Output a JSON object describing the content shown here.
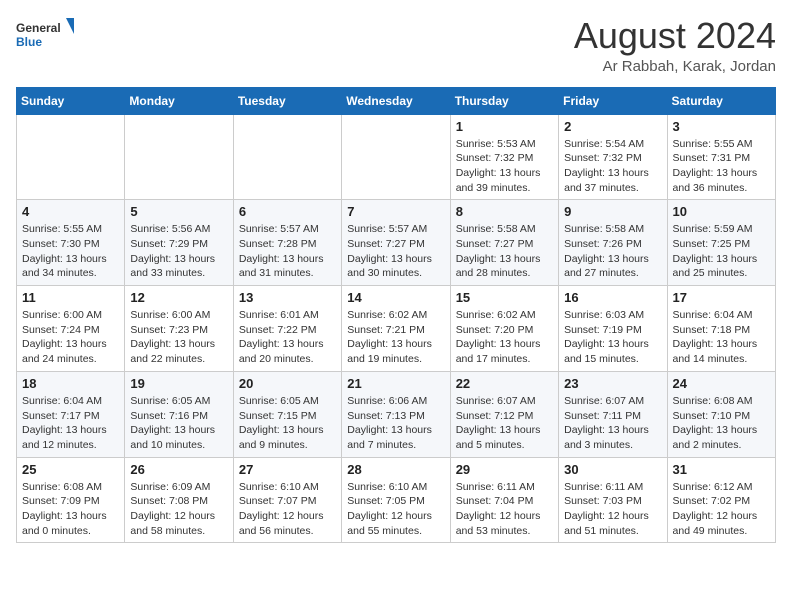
{
  "header": {
    "logo_line1": "General",
    "logo_line2": "Blue",
    "month_year": "August 2024",
    "location": "Ar Rabbah, Karak, Jordan"
  },
  "weekdays": [
    "Sunday",
    "Monday",
    "Tuesday",
    "Wednesday",
    "Thursday",
    "Friday",
    "Saturday"
  ],
  "weeks": [
    [
      {
        "day": "",
        "info": ""
      },
      {
        "day": "",
        "info": ""
      },
      {
        "day": "",
        "info": ""
      },
      {
        "day": "",
        "info": ""
      },
      {
        "day": "1",
        "info": "Sunrise: 5:53 AM\nSunset: 7:32 PM\nDaylight: 13 hours\nand 39 minutes."
      },
      {
        "day": "2",
        "info": "Sunrise: 5:54 AM\nSunset: 7:32 PM\nDaylight: 13 hours\nand 37 minutes."
      },
      {
        "day": "3",
        "info": "Sunrise: 5:55 AM\nSunset: 7:31 PM\nDaylight: 13 hours\nand 36 minutes."
      }
    ],
    [
      {
        "day": "4",
        "info": "Sunrise: 5:55 AM\nSunset: 7:30 PM\nDaylight: 13 hours\nand 34 minutes."
      },
      {
        "day": "5",
        "info": "Sunrise: 5:56 AM\nSunset: 7:29 PM\nDaylight: 13 hours\nand 33 minutes."
      },
      {
        "day": "6",
        "info": "Sunrise: 5:57 AM\nSunset: 7:28 PM\nDaylight: 13 hours\nand 31 minutes."
      },
      {
        "day": "7",
        "info": "Sunrise: 5:57 AM\nSunset: 7:27 PM\nDaylight: 13 hours\nand 30 minutes."
      },
      {
        "day": "8",
        "info": "Sunrise: 5:58 AM\nSunset: 7:27 PM\nDaylight: 13 hours\nand 28 minutes."
      },
      {
        "day": "9",
        "info": "Sunrise: 5:58 AM\nSunset: 7:26 PM\nDaylight: 13 hours\nand 27 minutes."
      },
      {
        "day": "10",
        "info": "Sunrise: 5:59 AM\nSunset: 7:25 PM\nDaylight: 13 hours\nand 25 minutes."
      }
    ],
    [
      {
        "day": "11",
        "info": "Sunrise: 6:00 AM\nSunset: 7:24 PM\nDaylight: 13 hours\nand 24 minutes."
      },
      {
        "day": "12",
        "info": "Sunrise: 6:00 AM\nSunset: 7:23 PM\nDaylight: 13 hours\nand 22 minutes."
      },
      {
        "day": "13",
        "info": "Sunrise: 6:01 AM\nSunset: 7:22 PM\nDaylight: 13 hours\nand 20 minutes."
      },
      {
        "day": "14",
        "info": "Sunrise: 6:02 AM\nSunset: 7:21 PM\nDaylight: 13 hours\nand 19 minutes."
      },
      {
        "day": "15",
        "info": "Sunrise: 6:02 AM\nSunset: 7:20 PM\nDaylight: 13 hours\nand 17 minutes."
      },
      {
        "day": "16",
        "info": "Sunrise: 6:03 AM\nSunset: 7:19 PM\nDaylight: 13 hours\nand 15 minutes."
      },
      {
        "day": "17",
        "info": "Sunrise: 6:04 AM\nSunset: 7:18 PM\nDaylight: 13 hours\nand 14 minutes."
      }
    ],
    [
      {
        "day": "18",
        "info": "Sunrise: 6:04 AM\nSunset: 7:17 PM\nDaylight: 13 hours\nand 12 minutes."
      },
      {
        "day": "19",
        "info": "Sunrise: 6:05 AM\nSunset: 7:16 PM\nDaylight: 13 hours\nand 10 minutes."
      },
      {
        "day": "20",
        "info": "Sunrise: 6:05 AM\nSunset: 7:15 PM\nDaylight: 13 hours\nand 9 minutes."
      },
      {
        "day": "21",
        "info": "Sunrise: 6:06 AM\nSunset: 7:13 PM\nDaylight: 13 hours\nand 7 minutes."
      },
      {
        "day": "22",
        "info": "Sunrise: 6:07 AM\nSunset: 7:12 PM\nDaylight: 13 hours\nand 5 minutes."
      },
      {
        "day": "23",
        "info": "Sunrise: 6:07 AM\nSunset: 7:11 PM\nDaylight: 13 hours\nand 3 minutes."
      },
      {
        "day": "24",
        "info": "Sunrise: 6:08 AM\nSunset: 7:10 PM\nDaylight: 13 hours\nand 2 minutes."
      }
    ],
    [
      {
        "day": "25",
        "info": "Sunrise: 6:08 AM\nSunset: 7:09 PM\nDaylight: 13 hours\nand 0 minutes."
      },
      {
        "day": "26",
        "info": "Sunrise: 6:09 AM\nSunset: 7:08 PM\nDaylight: 12 hours\nand 58 minutes."
      },
      {
        "day": "27",
        "info": "Sunrise: 6:10 AM\nSunset: 7:07 PM\nDaylight: 12 hours\nand 56 minutes."
      },
      {
        "day": "28",
        "info": "Sunrise: 6:10 AM\nSunset: 7:05 PM\nDaylight: 12 hours\nand 55 minutes."
      },
      {
        "day": "29",
        "info": "Sunrise: 6:11 AM\nSunset: 7:04 PM\nDaylight: 12 hours\nand 53 minutes."
      },
      {
        "day": "30",
        "info": "Sunrise: 6:11 AM\nSunset: 7:03 PM\nDaylight: 12 hours\nand 51 minutes."
      },
      {
        "day": "31",
        "info": "Sunrise: 6:12 AM\nSunset: 7:02 PM\nDaylight: 12 hours\nand 49 minutes."
      }
    ]
  ]
}
